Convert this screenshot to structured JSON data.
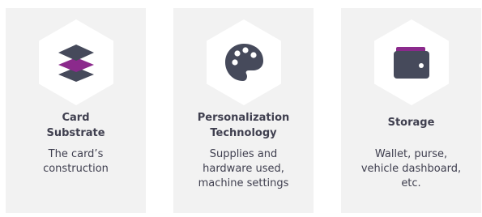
{
  "colors": {
    "card_background": "#f2f2f2",
    "hexagon": "#ffffff",
    "icon_dark": "#464a5b",
    "accent_purple": "#8b2a8c",
    "text": "#3f3f4f"
  },
  "cards": [
    {
      "icon": "layers-icon",
      "title_lines": [
        "Card",
        "Substrate"
      ],
      "desc_lines": [
        "The card’s",
        "construction"
      ]
    },
    {
      "icon": "palette-icon",
      "title_lines": [
        "Personalization",
        "Technology"
      ],
      "desc_lines": [
        "Supplies and",
        "hardware used,",
        "machine settings"
      ]
    },
    {
      "icon": "wallet-icon",
      "title_lines": [
        "Storage"
      ],
      "desc_lines": [
        "Wallet, purse,",
        "vehicle dashboard,",
        "etc."
      ]
    }
  ]
}
